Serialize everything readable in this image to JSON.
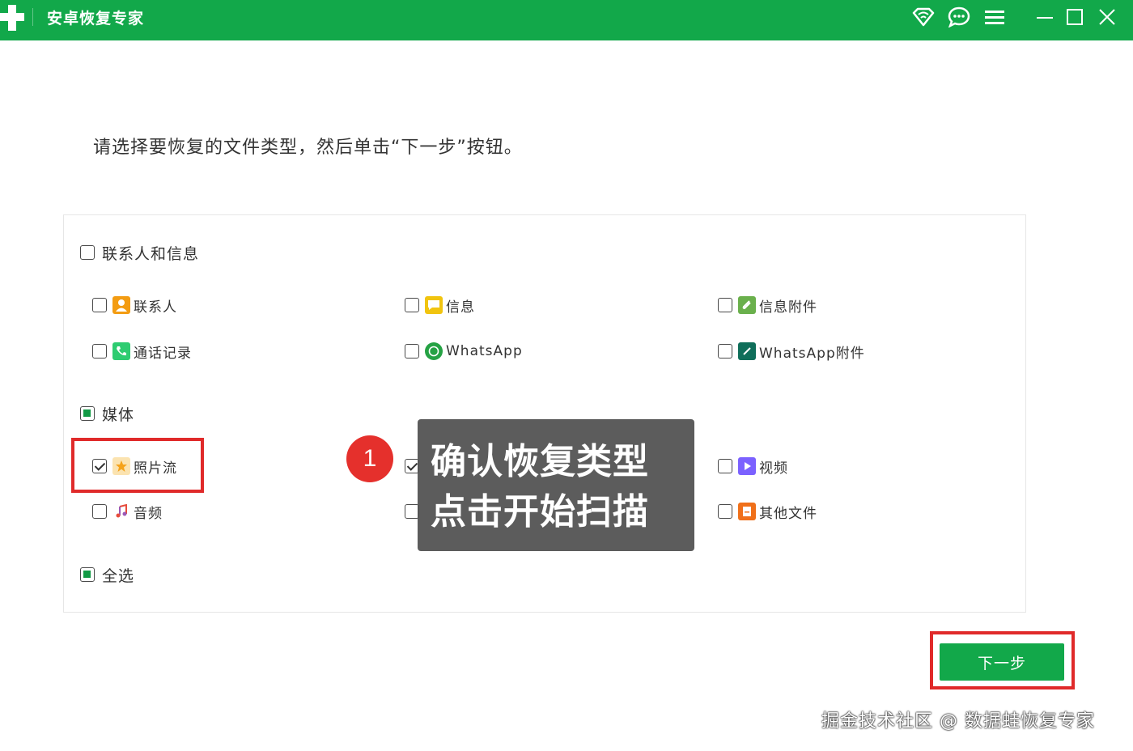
{
  "app": {
    "title": "安卓恢复专家"
  },
  "titlebar_icons": [
    "wifi-diamond-icon",
    "chat-icon",
    "menu-icon",
    "minimize-icon",
    "maximize-icon",
    "close-icon"
  ],
  "instruction": "请选择要恢复的文件类型，然后单击“下一步”按钮。",
  "groups": {
    "contacts_messages": {
      "label": "联系人和信息",
      "state": "unchecked",
      "items": [
        {
          "label": "联系人",
          "icon": "contact-icon",
          "color": "#f39c12",
          "checked": false
        },
        {
          "label": "信息",
          "icon": "message-icon",
          "color": "#f1c40f",
          "checked": false
        },
        {
          "label": "信息附件",
          "icon": "attachment-icon",
          "color": "#6ab04c",
          "checked": false
        },
        {
          "label": "通话记录",
          "icon": "phone-icon",
          "color": "#2ecc71",
          "checked": false
        },
        {
          "label": "WhatsApp",
          "icon": "whatsapp-icon",
          "color": "#25a244",
          "checked": false
        },
        {
          "label": "WhatsApp附件",
          "icon": "whatsapp-attachment-icon",
          "color": "#0f6e5a",
          "checked": false
        }
      ]
    },
    "media": {
      "label": "媒体",
      "state": "partial",
      "items": [
        {
          "label": "照片流",
          "icon": "star-photo-icon",
          "color": "#f5b31b",
          "checked": true
        },
        {
          "label": "视频",
          "icon": "video-play-icon",
          "color": "#7b61ff",
          "checked": false
        },
        {
          "label": "音频",
          "icon": "music-icon",
          "color": "#e74c3c",
          "checked": false
        },
        {
          "label": "其他文件",
          "icon": "file-icon",
          "color": "#f0701a",
          "checked": false
        }
      ]
    },
    "select_all": {
      "label": "全选",
      "state": "partial"
    }
  },
  "overlay": {
    "step_number": "1",
    "line1": "确认恢复类型",
    "line2": "点击开始扫描"
  },
  "next_button": "下一步",
  "watermark": "掘金技术社区 @ 数据蛙恢复专家",
  "colors": {
    "brand_green": "#12a84a",
    "highlight_red": "#e02a2a",
    "callout_red": "#e5302c"
  }
}
